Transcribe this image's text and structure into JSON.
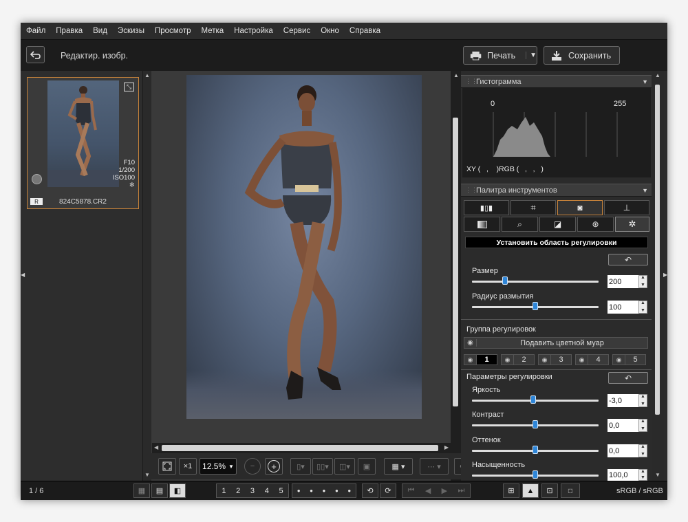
{
  "menu": [
    "Файл",
    "Правка",
    "Вид",
    "Эскизы",
    "Просмотр",
    "Метка",
    "Настройка",
    "Сервис",
    "Окно",
    "Справка"
  ],
  "toolbar": {
    "title": "Редактир. изобр.",
    "print_label": "Печать",
    "save_label": "Сохранить"
  },
  "thumbnail": {
    "filename": "824C5878.CR2",
    "aperture": "F10",
    "shutter": "1/200",
    "iso": "ISO100",
    "badge": "R"
  },
  "bottom_tools": {
    "zoom_1x": "×1",
    "zoom_value": "12.5%"
  },
  "histogram": {
    "header": "Гистограмма",
    "min_label": "0",
    "max_label": "255",
    "readout": "XY (   ,    )RGB (   ,   ,   )"
  },
  "tools_palette": {
    "header": "Палитра инструментов",
    "set_area_label": "Установить область регулировки",
    "size_label": "Размер",
    "size_value": "200",
    "size_level": 0.26,
    "blur_label": "Радиус размытия",
    "blur_value": "100",
    "blur_level": 0.5,
    "group_label": "Группа регулировок",
    "moire_label": "Подавить цветной муар",
    "groups": [
      "1",
      "2",
      "3",
      "4",
      "5"
    ],
    "params_label": "Параметры регулировки",
    "brightness_label": "Яркость",
    "brightness_value": "-3,0",
    "brightness_level": 0.48,
    "contrast_label": "Контраст",
    "contrast_value": "0,0",
    "contrast_level": 0.5,
    "hue_label": "Оттенок",
    "hue_value": "0,0",
    "hue_level": 0.5,
    "saturation_label": "Насыщенность",
    "saturation_value": "100,0",
    "saturation_level": 0.5
  },
  "status": {
    "page_counter": "1 / 6",
    "color_space": "sRGB / sRGB",
    "ratings": [
      "1",
      "2",
      "3",
      "4",
      "5"
    ]
  },
  "colors": {
    "accent": "#2f86d8",
    "selection_border": "#c9843a"
  }
}
